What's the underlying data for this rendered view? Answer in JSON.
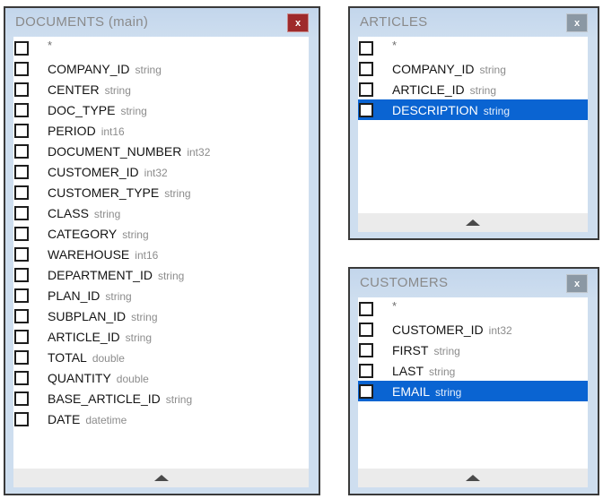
{
  "panels": [
    {
      "id": "documents",
      "title": "DOCUMENTS (main)",
      "close_label": "x",
      "close_state": "active",
      "star_row": "*",
      "collapse_icon": "up-arrow-icon",
      "fields": [
        {
          "name": "COMPANY_ID",
          "type": "string",
          "selected": false
        },
        {
          "name": "CENTER",
          "type": "string",
          "selected": false
        },
        {
          "name": "DOC_TYPE",
          "type": "string",
          "selected": false
        },
        {
          "name": "PERIOD",
          "type": "int16",
          "selected": false
        },
        {
          "name": "DOCUMENT_NUMBER",
          "type": "int32",
          "selected": false
        },
        {
          "name": "CUSTOMER_ID",
          "type": "int32",
          "selected": false
        },
        {
          "name": "CUSTOMER_TYPE",
          "type": "string",
          "selected": false
        },
        {
          "name": "CLASS",
          "type": "string",
          "selected": false
        },
        {
          "name": "CATEGORY",
          "type": "string",
          "selected": false
        },
        {
          "name": "WAREHOUSE",
          "type": "int16",
          "selected": false
        },
        {
          "name": "DEPARTMENT_ID",
          "type": "string",
          "selected": false
        },
        {
          "name": "PLAN_ID",
          "type": "string",
          "selected": false
        },
        {
          "name": "SUBPLAN_ID",
          "type": "string",
          "selected": false
        },
        {
          "name": "ARTICLE_ID",
          "type": "string",
          "selected": false
        },
        {
          "name": "TOTAL",
          "type": "double",
          "selected": false
        },
        {
          "name": "QUANTITY",
          "type": "double",
          "selected": false
        },
        {
          "name": "BASE_ARTICLE_ID",
          "type": "string",
          "selected": false
        },
        {
          "name": "DATE",
          "type": "datetime",
          "selected": false
        }
      ]
    },
    {
      "id": "articles",
      "title": "ARTICLES",
      "close_label": "x",
      "close_state": "inactive",
      "star_row": "*",
      "collapse_icon": "up-arrow-icon",
      "fields": [
        {
          "name": "COMPANY_ID",
          "type": "string",
          "selected": false
        },
        {
          "name": "ARTICLE_ID",
          "type": "string",
          "selected": false
        },
        {
          "name": "DESCRIPTION",
          "type": "string",
          "selected": true
        }
      ]
    },
    {
      "id": "customers",
      "title": "CUSTOMERS",
      "close_label": "x",
      "close_state": "inactive",
      "star_row": "*",
      "collapse_icon": "up-arrow-icon",
      "fields": [
        {
          "name": "CUSTOMER_ID",
          "type": "int32",
          "selected": false
        },
        {
          "name": "FIRST",
          "type": "string",
          "selected": false
        },
        {
          "name": "LAST",
          "type": "string",
          "selected": false
        },
        {
          "name": "EMAIL",
          "type": "string",
          "selected": true
        }
      ]
    }
  ],
  "colors": {
    "selection_blue": "#0a64d2",
    "close_active_red": "#9e2a2b",
    "close_inactive_gray": "#8b98a4",
    "panel_frame_blue": "#cedeef",
    "panel_border": "#3a3a3a",
    "footer_gray": "#ebebeb",
    "title_gray": "#8a8a8a"
  }
}
